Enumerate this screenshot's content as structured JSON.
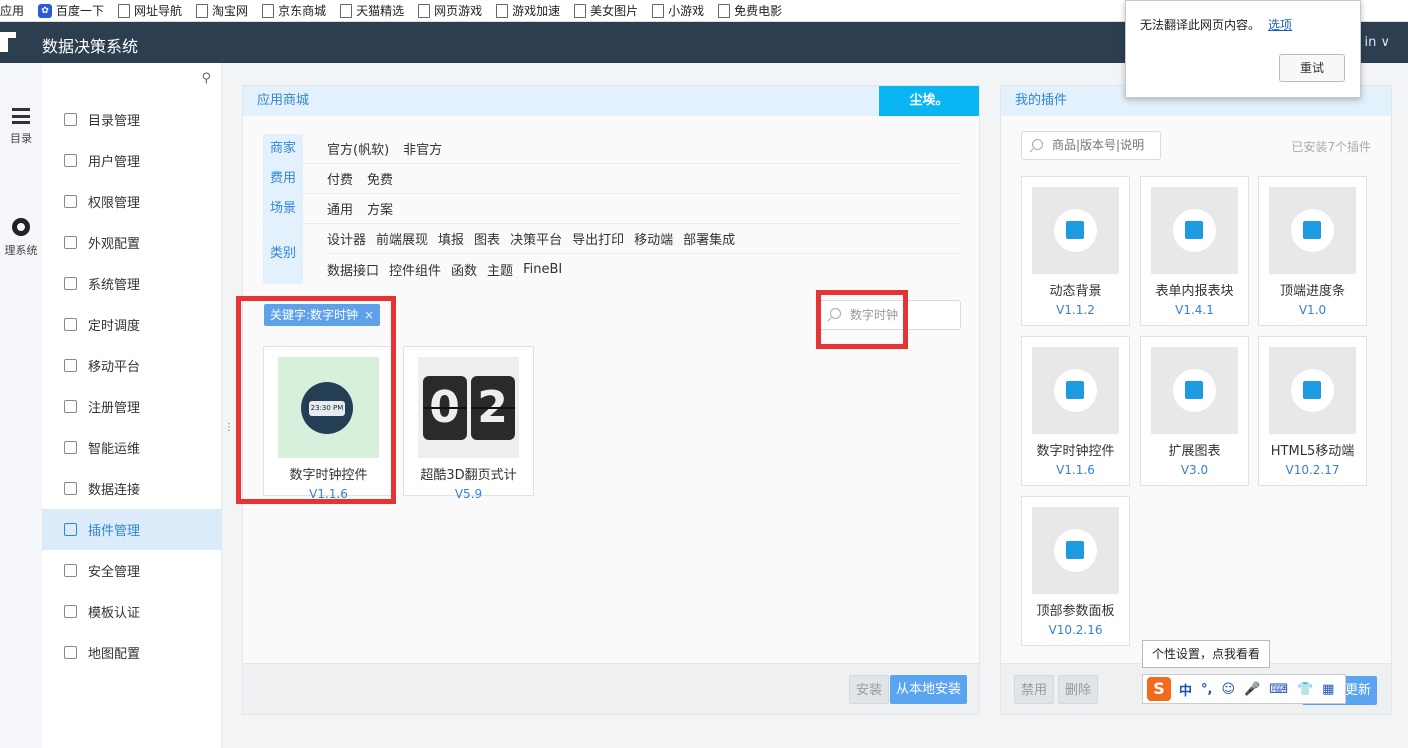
{
  "bookmarks": [
    "应用",
    "百度一下",
    "网址导航",
    "淘宝网",
    "京东商城",
    "天猫精选",
    "网页游戏",
    "游戏加速",
    "美女图片",
    "小游戏",
    "免费电影"
  ],
  "header": {
    "title": "数据决策系统",
    "user": "in ∨"
  },
  "iconstrip": {
    "catalog": "目录",
    "system": "理系统"
  },
  "sidebar": {
    "items": [
      {
        "label": "目录管理"
      },
      {
        "label": "用户管理"
      },
      {
        "label": "权限管理"
      },
      {
        "label": "外观配置"
      },
      {
        "label": "系统管理"
      },
      {
        "label": "定时调度"
      },
      {
        "label": "移动平台"
      },
      {
        "label": "注册管理"
      },
      {
        "label": "智能运维"
      },
      {
        "label": "数据连接"
      },
      {
        "label": "插件管理"
      },
      {
        "label": "安全管理"
      },
      {
        "label": "模板认证"
      },
      {
        "label": "地图配置"
      }
    ]
  },
  "store": {
    "title": "应用商城",
    "brand": "尘埃。",
    "filters": {
      "vendor": {
        "key": "商家",
        "values": [
          "官方(帆软)",
          "非官方"
        ]
      },
      "fee": {
        "key": "费用",
        "values": [
          "付费",
          "免费"
        ]
      },
      "scene": {
        "key": "场景",
        "values": [
          "通用",
          "方案"
        ]
      },
      "category": {
        "key": "类别",
        "line1": [
          "设计器",
          "前端展现",
          "填报",
          "图表",
          "决策平台",
          "导出打印",
          "移动端",
          "部署集成"
        ],
        "line2": [
          "数据接口",
          "控件组件",
          "函数",
          "主题",
          "FineBI"
        ]
      }
    },
    "keyword_chip": "关键字:数字时钟",
    "search_value": "数字时钟",
    "cards": [
      {
        "name": "数字时钟控件",
        "version": "V1.1.6",
        "face": "23:30 PM"
      },
      {
        "name": "超酷3D翻页式计",
        "version": "V5.9",
        "digits": [
          "0",
          "2"
        ]
      }
    ],
    "install_btn": "安装",
    "local_install_btn": "从本地安装"
  },
  "mine": {
    "title": "我的插件",
    "search_placeholder": "商品|版本号|说明",
    "installed": "已安装7个插件",
    "plugins": [
      {
        "name": "动态背景",
        "version": "V1.1.2"
      },
      {
        "name": "表单内报表块",
        "version": "V1.4.1"
      },
      {
        "name": "顶端进度条",
        "version": "V1.0"
      },
      {
        "name": "数字时钟控件",
        "version": "V1.1.6"
      },
      {
        "name": "扩展图表",
        "version": "V3.0"
      },
      {
        "name": "HTML5移动端",
        "version": "V10.2.17"
      },
      {
        "name": "顶部参数面板",
        "version": "V10.2.16"
      }
    ],
    "disable_btn": "禁用",
    "delete_btn": "删除",
    "update_btn": "更新"
  },
  "translate_popup": {
    "message": "无法翻译此网页内容。",
    "options": "选项",
    "retry": "重试"
  },
  "ime": {
    "tip": "个性设置，点我看看",
    "logo": "S",
    "mode": "中",
    "punct": "°,",
    "emoji": "☺",
    "voice": "🎤",
    "keyboard": "⌨",
    "skin": "👕",
    "grid": "▦"
  },
  "colors": {
    "header_bg": "#2d3e50",
    "accent": "#2f86d8",
    "brand_tag": "#09b5f3",
    "highlight": "#e63333"
  }
}
